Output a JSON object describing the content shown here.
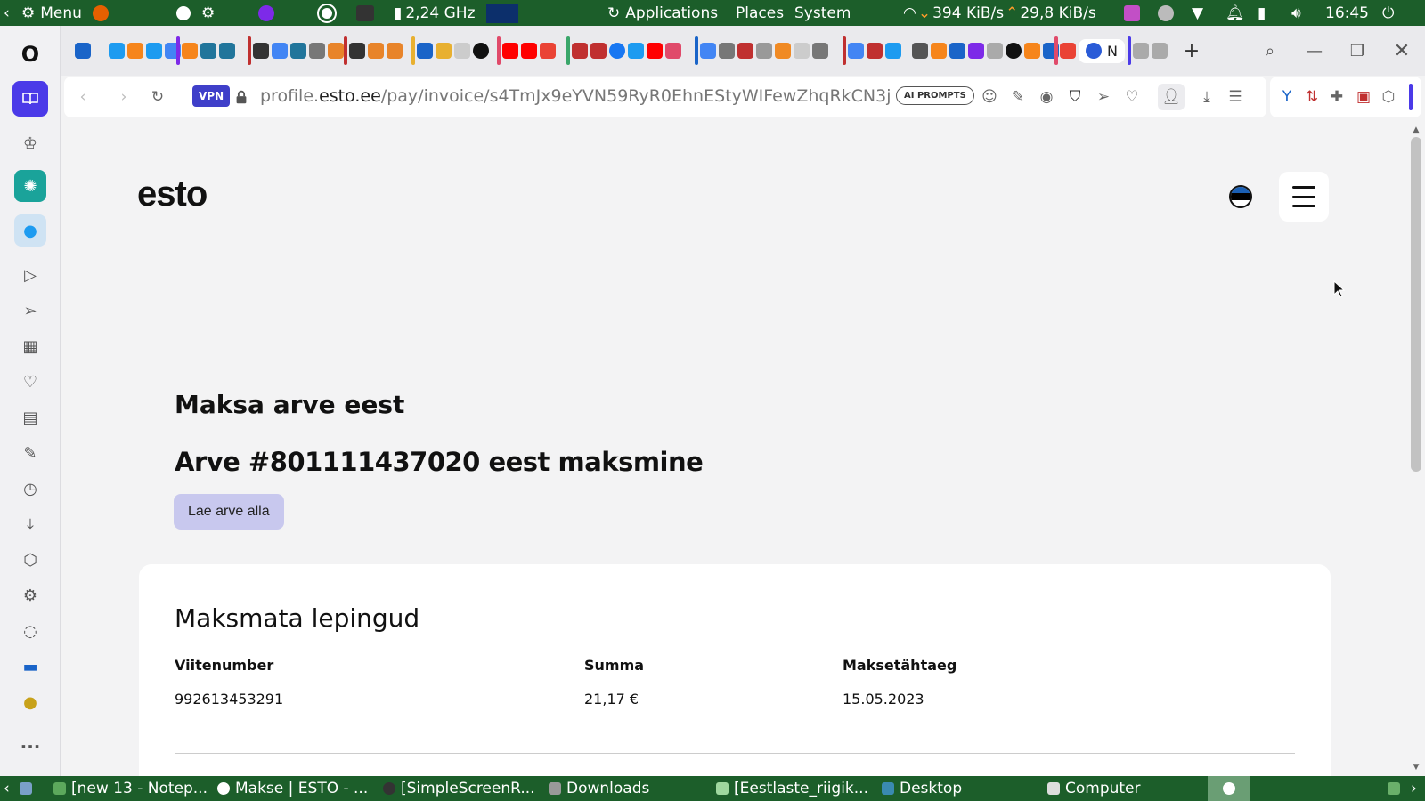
{
  "system_panel": {
    "menu_label": "Menu",
    "cpu_freq": "2,24 GHz",
    "applications_label": "Applications",
    "places_label": "Places",
    "system_label": "System",
    "net_down": "394 KiB/s",
    "net_up": "29,8 KiB/s",
    "clock": "16:45"
  },
  "browser": {
    "active_tab_label": "N",
    "address": {
      "vpn_label": "VPN",
      "url_host_prefix": "profile.",
      "url_host": "esto.ee",
      "url_path": "/pay/invoice/s4TmJx9eYVN59RyR0EhnEStyWIFewZhqRkCN3j",
      "ai_prompts_label": "AI PROMPTS"
    }
  },
  "page": {
    "logo_text": "esto",
    "pay_title": "Maksa arve eest",
    "invoice_heading": "Arve #801111437020 eest maksmine",
    "download_label": "Lae arve alla",
    "card": {
      "title": "Maksmata lepingud",
      "columns": [
        "Viitenumber",
        "Summa",
        "Maksetähtaeg"
      ],
      "rows": [
        {
          "reference": "992613453291",
          "amount": "21,17 €",
          "due_date": "15.05.2023"
        }
      ]
    }
  },
  "taskbar": {
    "items": [
      "[new 13 - Notep...",
      "Makse | ESTO - ...",
      "[SimpleScreenR...",
      "Downloads",
      "[Eestlaste_riigik...",
      "Desktop",
      "Computer"
    ]
  },
  "colors": {
    "panel_green": "#1c5e2a",
    "download_button": "#c8c8ee",
    "vpn_badge": "#3f3fc9"
  }
}
